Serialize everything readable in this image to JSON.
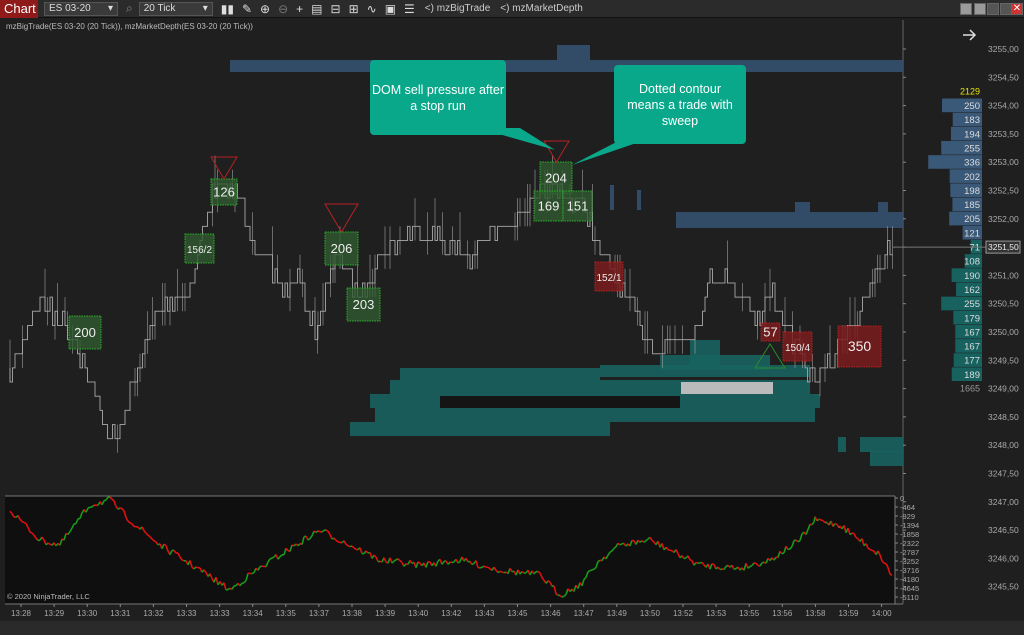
{
  "toolbar": {
    "chart_label": "Chart",
    "instrument": "ES 03-20",
    "interval": "20 Tick",
    "icons": [
      "bar-type-icon",
      "draw-pencil-icon",
      "zoom-in-icon",
      "zoom-out-icon",
      "crosshair-icon",
      "data-box-icon",
      "chart-trader-icon",
      "properties-icon",
      "strategy-icon",
      "template-icon",
      "indicators-list-icon"
    ],
    "indicators": [
      "<) mzBigTrade",
      "<) mzMarketDepth"
    ]
  },
  "subtitle": "mzBigTrade(ES 03-20 (20 Tick)), mzMarketDepth(ES 03-20 (20 Tick))",
  "colors": {
    "ask": "#3a5878",
    "bid": "#17625f",
    "buy_trade": "#2f5a2f",
    "sell_trade": "#7a1c1c",
    "callout": "#0aa88a",
    "total_ask": "#e6e600"
  },
  "callouts": [
    {
      "text": "DOM sell pressure after a stop run"
    },
    {
      "text": "Dotted contour means a trade with sweep"
    }
  ],
  "trades": [
    {
      "label": "200",
      "side": "buy"
    },
    {
      "label": "156/2",
      "side": "buy"
    },
    {
      "label": "126",
      "side": "buy"
    },
    {
      "label": "206",
      "side": "buy"
    },
    {
      "label": "203",
      "side": "buy"
    },
    {
      "label": "204",
      "side": "buy"
    },
    {
      "label": "169",
      "side": "buy"
    },
    {
      "label": "151",
      "side": "buy"
    },
    {
      "label": "152/1",
      "side": "sell"
    },
    {
      "label": "57",
      "side": "sell"
    },
    {
      "label": "150/4",
      "side": "sell"
    },
    {
      "label": "350",
      "side": "sell"
    }
  ],
  "price_axis": {
    "ticks": [
      "3255,00",
      "3254,50",
      "3254,00",
      "3253,50",
      "3253,00",
      "3252,50",
      "3252,00",
      "3251,50",
      "3251,00",
      "3250,50",
      "3250,00",
      "3249,50",
      "3249,00",
      "3248,50",
      "3248,00",
      "3247,50",
      "3247,00",
      "3246,50",
      "3246,00",
      "3245,50"
    ],
    "last_price": "3251,50"
  },
  "dom": {
    "total_ask": "2129",
    "total_bid": "1665",
    "asks": [
      {
        "price": 3254.0,
        "size": 250
      },
      {
        "price": 3253.75,
        "size": 183
      },
      {
        "price": 3253.5,
        "size": 194
      },
      {
        "price": 3253.25,
        "size": 255
      },
      {
        "price": 3253.0,
        "size": 336
      },
      {
        "price": 3252.75,
        "size": 202
      },
      {
        "price": 3252.5,
        "size": 198
      },
      {
        "price": 3252.25,
        "size": 185
      },
      {
        "price": 3252.0,
        "size": 205
      },
      {
        "price": 3251.75,
        "size": 121
      }
    ],
    "last": {
      "price": 3251.5,
      "size": 71
    },
    "bids": [
      {
        "price": 3251.25,
        "size": 108
      },
      {
        "price": 3251.0,
        "size": 190
      },
      {
        "price": 3250.75,
        "size": 162
      },
      {
        "price": 3250.5,
        "size": 255
      },
      {
        "price": 3250.25,
        "size": 179
      },
      {
        "price": 3250.0,
        "size": 167
      },
      {
        "price": 3249.75,
        "size": 167
      },
      {
        "price": 3249.5,
        "size": 177
      },
      {
        "price": 3249.25,
        "size": 189
      }
    ]
  },
  "indicator_axis": [
    "0",
    "-464",
    "-929",
    "-1394",
    "-1858",
    "-2322",
    "-2787",
    "-3252",
    "-3716",
    "-4180",
    "-4645",
    "-5110"
  ],
  "time_axis": [
    "13:28",
    "13:29",
    "13:30",
    "13:31",
    "13:32",
    "13:33",
    "13:33",
    "13:34",
    "13:35",
    "13:37",
    "13:38",
    "13:39",
    "13:40",
    "13:42",
    "13:43",
    "13:45",
    "13:46",
    "13:47",
    "13:49",
    "13:50",
    "13:52",
    "13:53",
    "13:55",
    "13:56",
    "13:58",
    "13:59",
    "14:00"
  ],
  "copyright": "© 2020 NinjaTrader, LLC"
}
